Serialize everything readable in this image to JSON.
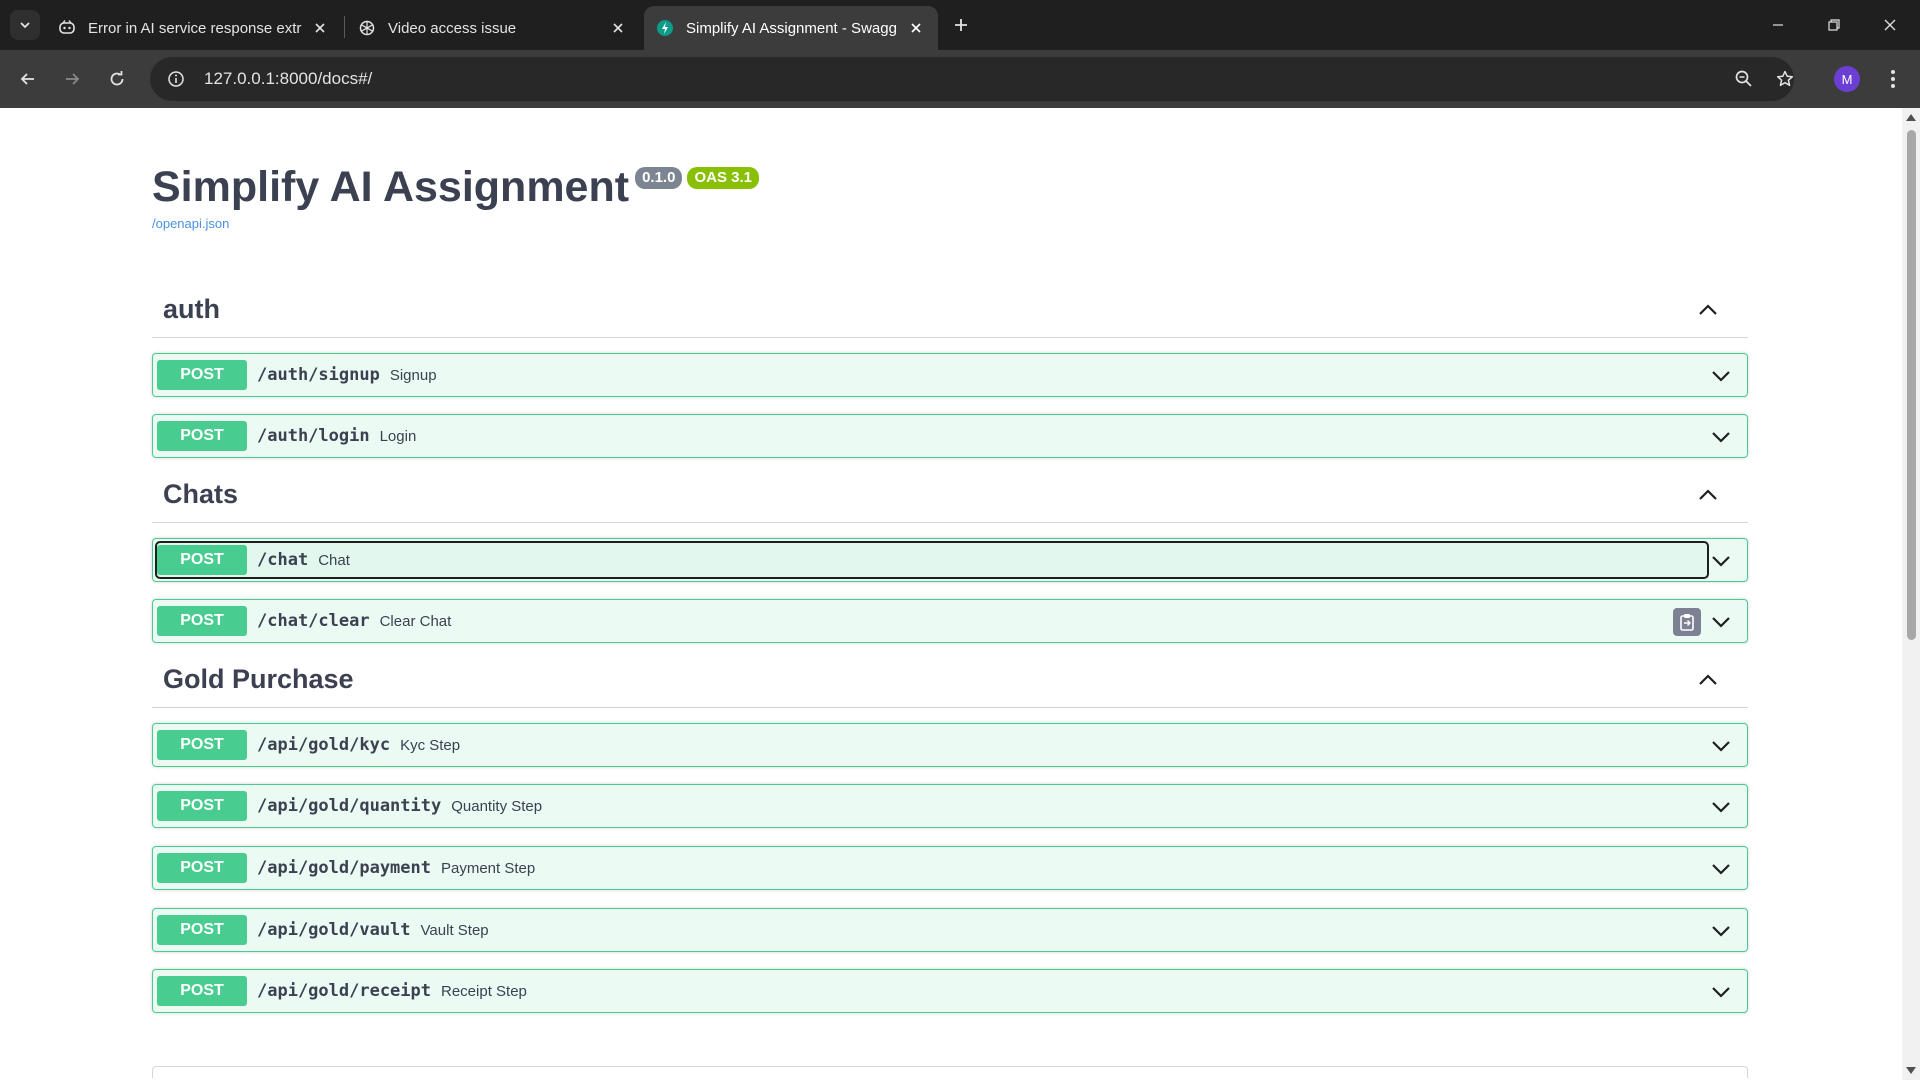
{
  "browser": {
    "tabs": [
      {
        "title": "Error in AI service response extr",
        "icon": "copilot-icon",
        "active": false
      },
      {
        "title": "Video access issue",
        "icon": "openai-icon",
        "active": false
      },
      {
        "title": "Simplify AI Assignment - Swagg",
        "icon": "swagger-icon",
        "active": true
      }
    ],
    "url": "127.0.0.1:8000/docs#/",
    "profile_initial": "M",
    "avatar_color": "#6b3fd4"
  },
  "info": {
    "title": "Simplify AI Assignment",
    "version": "0.1.0",
    "oas": "OAS 3.1",
    "spec_link": "/openapi.json"
  },
  "colors": {
    "post": "#49cc90",
    "version_badge": "#7d8492",
    "oas_badge": "#89bf04",
    "link": "#4990e2"
  },
  "sections": [
    {
      "name": "auth",
      "operations": [
        {
          "method": "POST",
          "path": "/auth/signup",
          "summary": "Signup"
        },
        {
          "method": "POST",
          "path": "/auth/login",
          "summary": "Login"
        }
      ]
    },
    {
      "name": "Chats",
      "operations": [
        {
          "method": "POST",
          "path": "/chat",
          "summary": "Chat"
        },
        {
          "method": "POST",
          "path": "/chat/clear",
          "summary": "Clear Chat"
        }
      ]
    },
    {
      "name": "Gold Purchase",
      "operations": [
        {
          "method": "POST",
          "path": "/api/gold/kyc",
          "summary": "Kyc Step"
        },
        {
          "method": "POST",
          "path": "/api/gold/quantity",
          "summary": "Quantity Step"
        },
        {
          "method": "POST",
          "path": "/api/gold/payment",
          "summary": "Payment Step"
        },
        {
          "method": "POST",
          "path": "/api/gold/vault",
          "summary": "Vault Step"
        },
        {
          "method": "POST",
          "path": "/api/gold/receipt",
          "summary": "Receipt Step"
        }
      ]
    }
  ]
}
